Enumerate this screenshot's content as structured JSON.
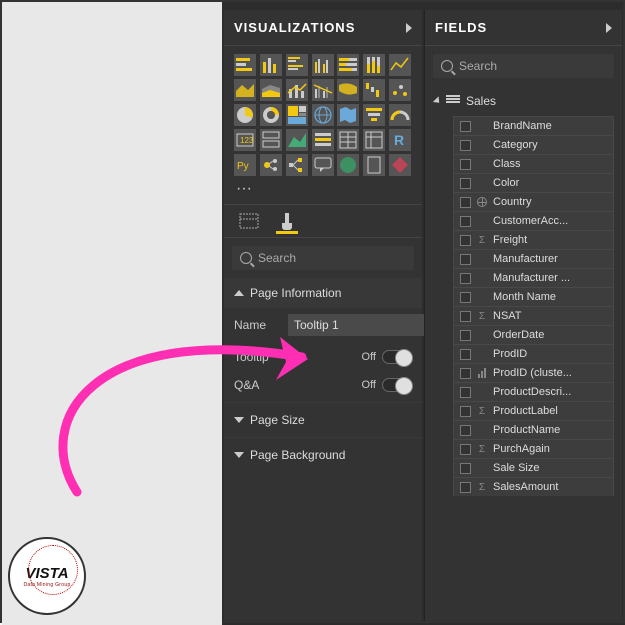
{
  "branding": {
    "name": "VISTA",
    "tagline": "Data Mining Group"
  },
  "visualizations": {
    "title": "VISUALIZATIONS",
    "search_placeholder": "Search",
    "section_page_info": "Page Information",
    "name_label": "Name",
    "name_value": "Tooltip 1",
    "tooltip_label": "Tooltip",
    "tooltip_state": "Off",
    "qa_label": "Q&A",
    "qa_state": "Off",
    "section_page_size": "Page Size",
    "section_page_background": "Page Background"
  },
  "fields": {
    "title": "FIELDS",
    "search_placeholder": "Search",
    "table": "Sales",
    "items": [
      {
        "label": "BrandName",
        "type": ""
      },
      {
        "label": "Category",
        "type": ""
      },
      {
        "label": "Class",
        "type": ""
      },
      {
        "label": "Color",
        "type": ""
      },
      {
        "label": "Country",
        "type": "geo"
      },
      {
        "label": "CustomerAcc...",
        "type": ""
      },
      {
        "label": "Freight",
        "type": "sum"
      },
      {
        "label": "Manufacturer",
        "type": ""
      },
      {
        "label": "Manufacturer ...",
        "type": ""
      },
      {
        "label": "Month Name",
        "type": ""
      },
      {
        "label": "NSAT",
        "type": "sum"
      },
      {
        "label": "OrderDate",
        "type": ""
      },
      {
        "label": "ProdID",
        "type": ""
      },
      {
        "label": "ProdID (cluste...",
        "type": "bin"
      },
      {
        "label": "ProductDescri...",
        "type": ""
      },
      {
        "label": "ProductLabel",
        "type": "sum"
      },
      {
        "label": "ProductName",
        "type": ""
      },
      {
        "label": "PurchAgain",
        "type": "sum"
      },
      {
        "label": "Sale Size",
        "type": ""
      },
      {
        "label": "SalesAmount",
        "type": "sum"
      }
    ]
  }
}
